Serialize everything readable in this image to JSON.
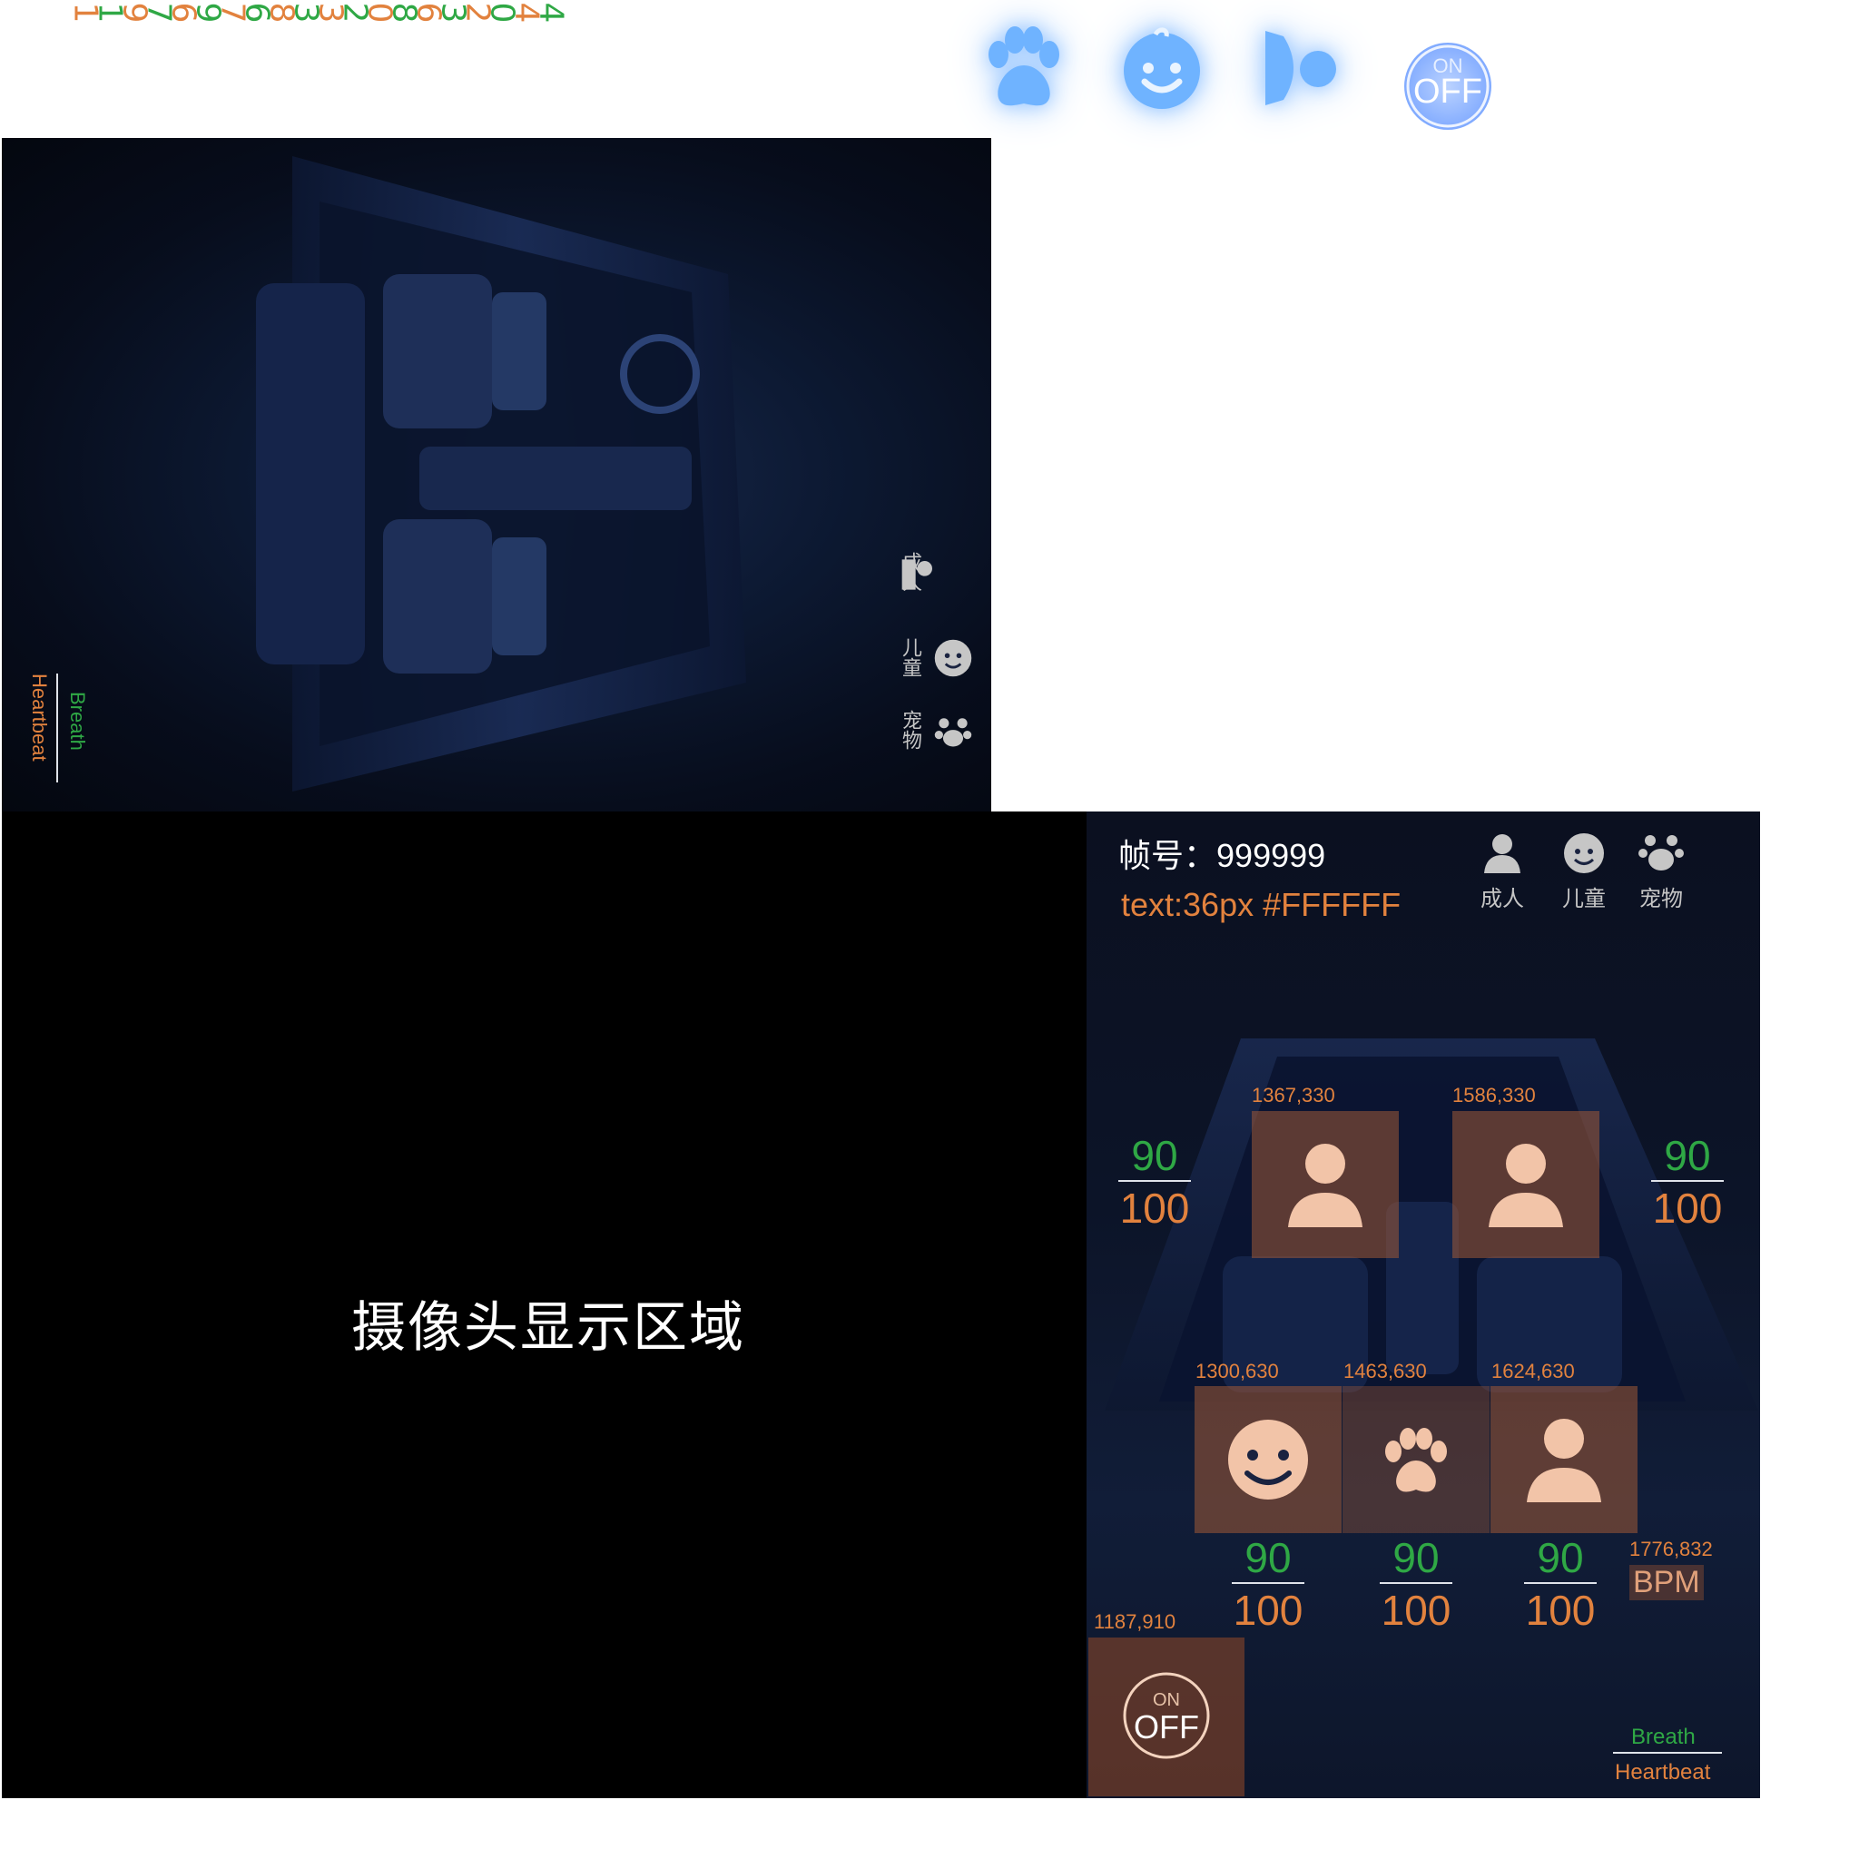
{
  "digit_strip": {
    "digits": [
      "1",
      "1",
      "9",
      "7",
      "6",
      "9",
      "7",
      "6",
      "8",
      "3",
      "3",
      "2",
      "0",
      "8",
      "6",
      "3",
      "2",
      "0",
      "4",
      "4"
    ],
    "colors": [
      "#e2823e",
      "#2fa845"
    ]
  },
  "top_icons": {
    "pet_icon": "paw-icon",
    "child_icon": "child-face-icon",
    "speaker_icon": "speaker-icon",
    "power": {
      "on": "ON",
      "off": "OFF"
    }
  },
  "vertical_panel": {
    "categories": [
      {
        "label": "成人",
        "icon": "adult-icon"
      },
      {
        "label": "儿童",
        "icon": "child-icon"
      },
      {
        "label": "宠物",
        "icon": "pet-icon"
      }
    ],
    "legend": {
      "breath": "Breath",
      "heartbeat": "Heartbeat"
    }
  },
  "camera": {
    "label": "摄像头显示区域"
  },
  "dashboard": {
    "frame_label": "帧号",
    "frame_value": "999999",
    "style_note": "text:36px #FFFFFF",
    "categories": [
      {
        "label": "成人",
        "icon": "adult-icon"
      },
      {
        "label": "儿童",
        "icon": "child-icon"
      },
      {
        "label": "宠物",
        "icon": "pet-icon"
      }
    ],
    "seats": [
      {
        "coord": "1367,330",
        "occupant": "adult"
      },
      {
        "coord": "1586,330",
        "occupant": "adult"
      },
      {
        "coord": "1300,630",
        "occupant": "child"
      },
      {
        "coord": "1463,630",
        "occupant": "pet"
      },
      {
        "coord": "1624,630",
        "occupant": "adult"
      }
    ],
    "vitals": {
      "left": {
        "breath": "90",
        "heartbeat": "100"
      },
      "right": {
        "breath": "90",
        "heartbeat": "100"
      },
      "rear_left": {
        "breath": "90",
        "heartbeat": "100"
      },
      "rear_mid": {
        "breath": "90",
        "heartbeat": "100"
      },
      "rear_right": {
        "breath": "90",
        "heartbeat": "100"
      }
    },
    "bpm_coord": "1776,832",
    "bpm_label": "BPM",
    "onoff_coord": "1187,910",
    "power": {
      "on": "ON",
      "off": "OFF"
    },
    "legend": {
      "breath": "Breath",
      "heartbeat": "Heartbeat"
    }
  }
}
